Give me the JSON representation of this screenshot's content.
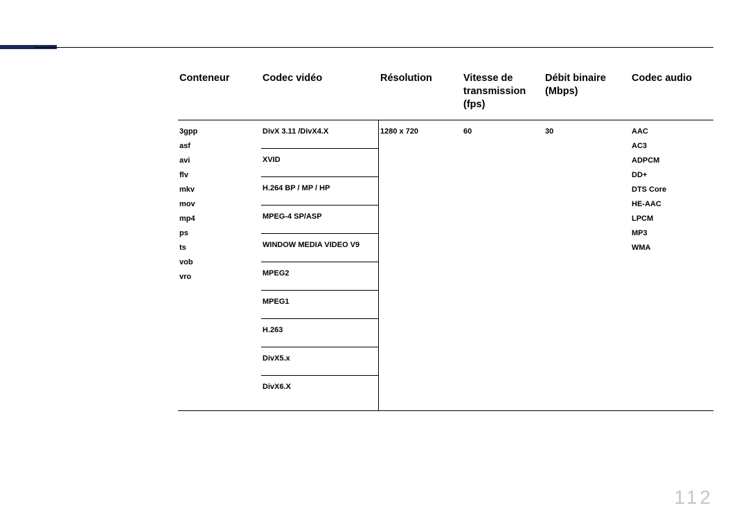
{
  "page_number": "112",
  "headers": {
    "container": "Conteneur",
    "video_codec": "Codec vidéo",
    "resolution": "Résolution",
    "fps": "Vitesse de transmission (fps)",
    "bitrate": "Débit binaire (Mbps)",
    "audio_codec": "Codec audio"
  },
  "containers": [
    "3gpp",
    "asf",
    "avi",
    "flv",
    "mkv",
    "mov",
    "mp4",
    "ps",
    "ts",
    "vob",
    "vro"
  ],
  "video_codecs": [
    "DivX 3.11 /DivX4.X",
    "XVID",
    "H.264 BP / MP / HP",
    "MPEG-4 SP/ASP",
    "WINDOW MEDIA VIDEO V9",
    "MPEG2",
    "MPEG1",
    "H.263",
    "DivX5.x",
    "DivX6.X"
  ],
  "resolution": "1280 x 720",
  "fps": "60",
  "bitrate": "30",
  "audio_codecs": [
    "AAC",
    "AC3",
    "ADPCM",
    "DD+",
    "DTS Core",
    "HE-AAC",
    "LPCM",
    "MP3",
    "WMA"
  ]
}
